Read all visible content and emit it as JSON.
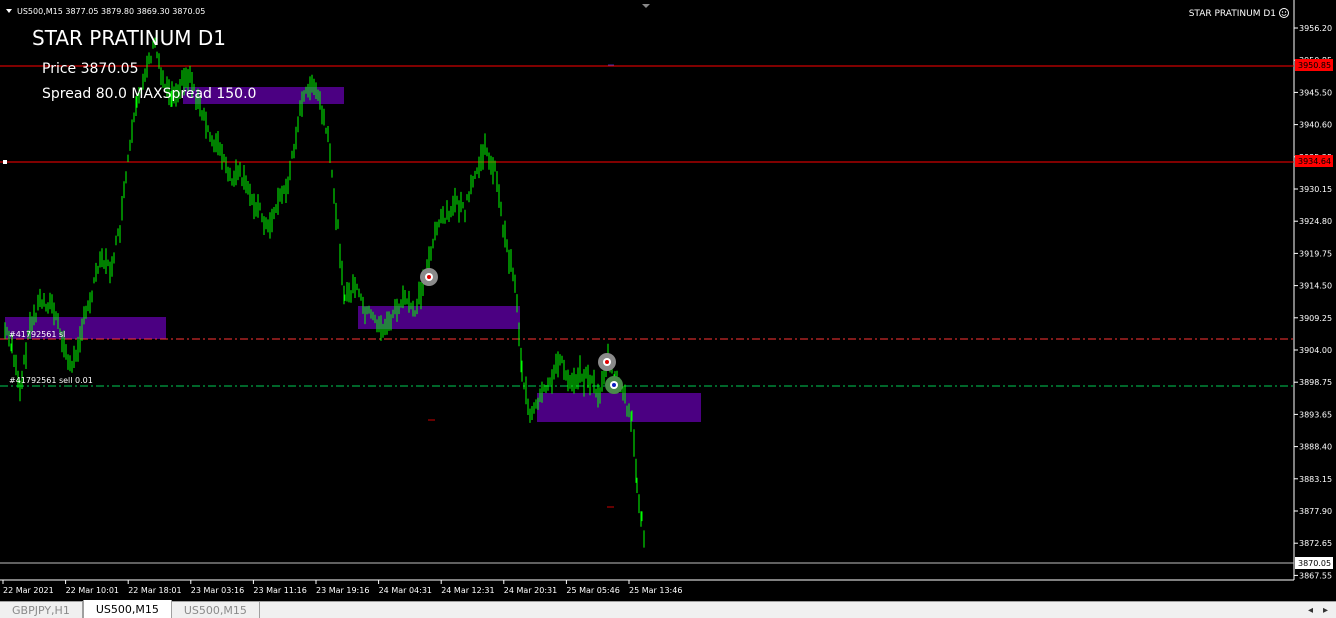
{
  "header": {
    "symbol_line": "US500,M15  3877.05 3879.80 3869.30 3870.05",
    "ea_title": "STAR PRATINUM D1",
    "indicator_title": "STAR PRATINUM D1",
    "price_label": "Price  3870.05",
    "spread_label": "Spread  80.0  MAXSpread  150.0"
  },
  "orders": {
    "sl_label": "#41792561 sl",
    "sell_label": "#41792561 sell 0.01"
  },
  "colors": {
    "background": "#000000",
    "candles": "#00ff00",
    "axis": "#ffffff",
    "zones": "#4b0082",
    "level_lines": "#ff0000",
    "sl_line": "#ff3333",
    "entry_line": "#00cc55",
    "bid_line": "#c0c0c0"
  },
  "price_axis": {
    "ticks": [
      "3956.20",
      "3950.85",
      "3945.50",
      "3940.60",
      "3935.25",
      "3930.15",
      "3924.80",
      "3919.75",
      "3914.50",
      "3909.25",
      "3904.00",
      "3898.75",
      "3893.65",
      "3888.40",
      "3883.15",
      "3877.90",
      "3872.65",
      "3867.55"
    ],
    "marker_upper": "3950.85",
    "marker_lower": "3934.64",
    "current_price": "3870.05"
  },
  "time_axis": {
    "ticks": [
      "22 Mar 2021",
      "22 Mar 10:01",
      "22 Mar 18:01",
      "23 Mar 03:16",
      "23 Mar 11:16",
      "23 Mar 19:16",
      "24 Mar 04:31",
      "24 Mar 12:31",
      "24 Mar 20:31",
      "25 Mar 05:46",
      "25 Mar 13:46"
    ]
  },
  "tabs": [
    {
      "label": "GBPJPY,H1",
      "active": false
    },
    {
      "label": "US500,M15",
      "active": true
    },
    {
      "label": "US500,M15",
      "active": false
    }
  ],
  "nav": {
    "left": "◂",
    "right": "▸"
  }
}
